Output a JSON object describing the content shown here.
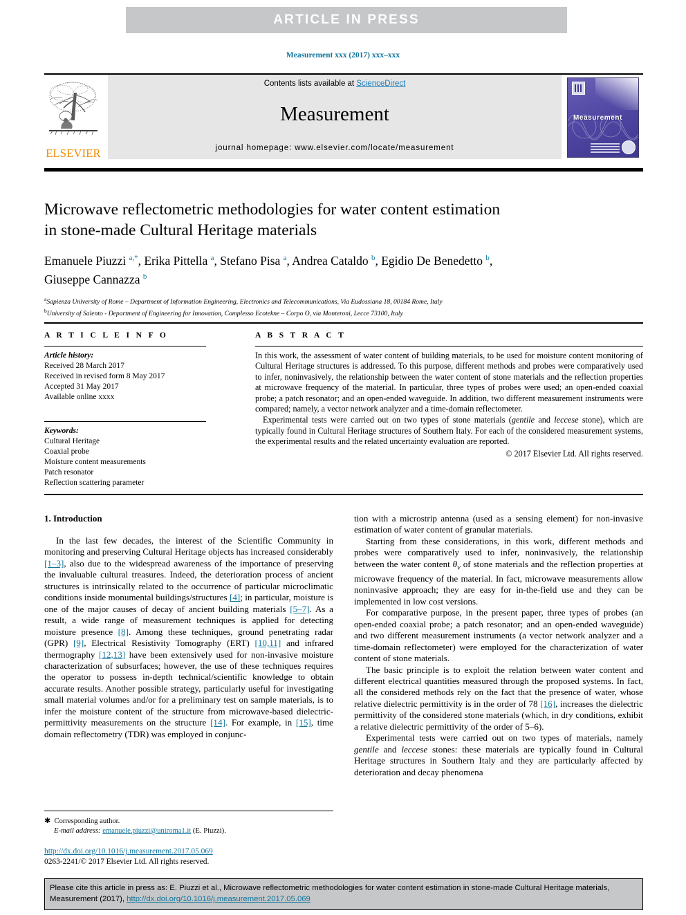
{
  "banner": {
    "text": "ARTICLE  IN  PRESS"
  },
  "running_head": "Measurement xxx (2017) xxx–xxx",
  "journal_header": {
    "publisher": "ELSEVIER",
    "contents_prefix": "Contents lists available at ",
    "contents_link": "ScienceDirect",
    "journal_title": "Measurement",
    "homepage": "journal homepage: www.elsevier.com/locate/measurement",
    "cover_name": "Measurement"
  },
  "article": {
    "title_line1": "Microwave reflectometric methodologies for water content estimation",
    "title_line2": "in stone-made Cultural Heritage materials",
    "authors_line1": "Emanuele Piuzzi a,*, Erika Pittella a, Stefano Pisa a, Andrea Cataldo b, Egidio De Benedetto b,",
    "authors_line2": "Giuseppe Cannazza b",
    "affiliation_a": "Sapienza University of Rome – Department of Information Engineering, Electronics and Telecommunications, Via Eudossiana 18, 00184 Rome, Italy",
    "affiliation_b": "University of Salento - Department of Engineering for Innovation, Complesso Ecotekne – Corpo O, via Monteroni, Lecce 73100, Italy"
  },
  "article_info": {
    "heading": "A R T I C L E   I N F O",
    "history_label": "Article history:",
    "history": [
      "Received 28 March 2017",
      "Received in revised form 8 May 2017",
      "Accepted 31 May 2017",
      "Available online xxxx"
    ],
    "keywords_label": "Keywords:",
    "keywords": [
      "Cultural Heritage",
      "Coaxial probe",
      "Moisture content measurements",
      "Patch resonator",
      "Reflection scattering parameter"
    ]
  },
  "abstract": {
    "heading": "A B S T R A C T",
    "paragraph1": "In this work, the assessment of water content of building materials, to be used for moisture content monitoring of Cultural Heritage structures is addressed. To this purpose, different methods and probes were comparatively used to infer, noninvasively, the relationship between the water content of stone materials and the reflection properties at microwave frequency of the material. In particular, three types of probes were used; an open-ended coaxial probe; a patch resonator; and an open-ended waveguide. In addition, two different measurement instruments were compared; namely, a vector network analyzer and a time-domain reflectometer.",
    "paragraph2_a": "Experimental tests were carried out on two types of stone materials (",
    "paragraph2_i1": "gentile",
    "paragraph2_b": " and ",
    "paragraph2_i2": "leccese",
    "paragraph2_c": " stone), which are typically found in Cultural Heritage structures of Southern Italy. For each of the considered measurement systems, the experimental results and the related uncertainty evaluation are reported.",
    "rights": "© 2017 Elsevier Ltd. All rights reserved."
  },
  "body": {
    "section_heading": "1. Introduction",
    "left": {
      "p1_a": "In the last few decades, the interest of the Scientific Community in monitoring and preserving Cultural Heritage objects has increased considerably ",
      "p1_r1": "[1–3]",
      "p1_b": ", also due to the widespread awareness of the importance of preserving the invaluable cultural treasures. Indeed, the deterioration process of ancient structures is intrinsically related to the occurrence of particular microclimatic conditions inside monumental buildings/structures ",
      "p1_r2": "[4]",
      "p1_c": "; in particular, moisture is one of the major causes of decay of ancient building materials ",
      "p1_r3": "[5–7]",
      "p1_d": ". As a result, a wide range of measurement techniques is applied for detecting moisture presence ",
      "p1_r4": "[8]",
      "p1_e": ". Among these techniques, ground penetrating radar (GPR) ",
      "p1_r5": "[9]",
      "p1_f": ", Electrical Resistivity Tomography (ERT) ",
      "p1_r6": "[10,11]",
      "p1_g": " and infrared thermography ",
      "p1_r7": "[12,13]",
      "p1_h": " have been extensively used for non-invasive moisture characterization of subsurfaces; however, the use of these techniques requires the operator to possess in-depth technical/scientific knowledge to obtain accurate results. Another possible strategy, particularly useful for investigating small material volumes and/or for a preliminary test on sample materials, is to infer the moisture content of the structure from microwave-based dielectric-permittivity measurements on the structure ",
      "p1_r8": "[14]",
      "p1_i": ". For example, in ",
      "p1_r9": "[15]",
      "p1_j": ", time domain reflectometry (TDR) was employed in conjunc-"
    },
    "right": {
      "p1_cont": "tion with a microstrip antenna (used as a sensing element) for non-invasive estimation of water content of granular materials.",
      "p2_a": "Starting from these considerations, in this work, different methods and probes were comparatively used to infer, noninvasively, the relationship between the water content ",
      "p2_theta": "θv",
      "p2_b": " of stone materials and the reflection properties at microwave frequency of the material. In fact, microwave measurements allow noninvasive approach; they are easy for in-the-field use and they can be implemented in low cost versions.",
      "p3": "For comparative purpose, in the present paper, three types of probes (an open-ended coaxial probe; a patch resonator; and an open-ended waveguide) and two different measurement instruments (a vector network analyzer and a time-domain reflectometer) were employed for the characterization of water content of stone materials.",
      "p4_a": "The basic principle is to exploit the relation between water content and different electrical quantities measured through the proposed systems. In fact, all the considered methods rely on the fact that the presence of water, whose relative dielectric permittivity is in the order of 78 ",
      "p4_r1": "[16]",
      "p4_b": ", increases the dielectric permittivity of the considered stone materials (which, in dry conditions, exhibit a relative dielectric permittivity of the order of 5–6).",
      "p5_a": "Experimental tests were carried out on two types of materials, namely ",
      "p5_i1": "gentile",
      "p5_b": " and ",
      "p5_i2": "leccese",
      "p5_c": " stones: these materials are typically found in Cultural Heritage structures in Southern Italy and they are particularly affected by deterioration and decay phenomena"
    }
  },
  "footnote": {
    "corresponding": "Corresponding author.",
    "email_label": "E-mail address:",
    "email": "emanuele.piuzzi@uniroma1.it",
    "email_suffix": " (E. Piuzzi).",
    "doi": "http://dx.doi.org/10.1016/j.measurement.2017.05.069",
    "issn": "0263-2241/© 2017 Elsevier Ltd. All rights reserved."
  },
  "cite_box": {
    "text_a": "Please cite this article in press as: E. Piuzzi et al., Microwave reflectometric methodologies for water content estimation in stone-made Cultural Heritage materials, Measurement (2017), ",
    "link": "http://dx.doi.org/10.1016/j.measurement.2017.05.069"
  },
  "colors": {
    "banner_bg": "#c6c7c9",
    "link_blue": "#10759c",
    "sciencedirect_blue": "#1a7bb9",
    "elsevier_orange": "#ed8b00",
    "header_panel": "#e6e6e6",
    "cover_purple": "#4e45a0"
  }
}
